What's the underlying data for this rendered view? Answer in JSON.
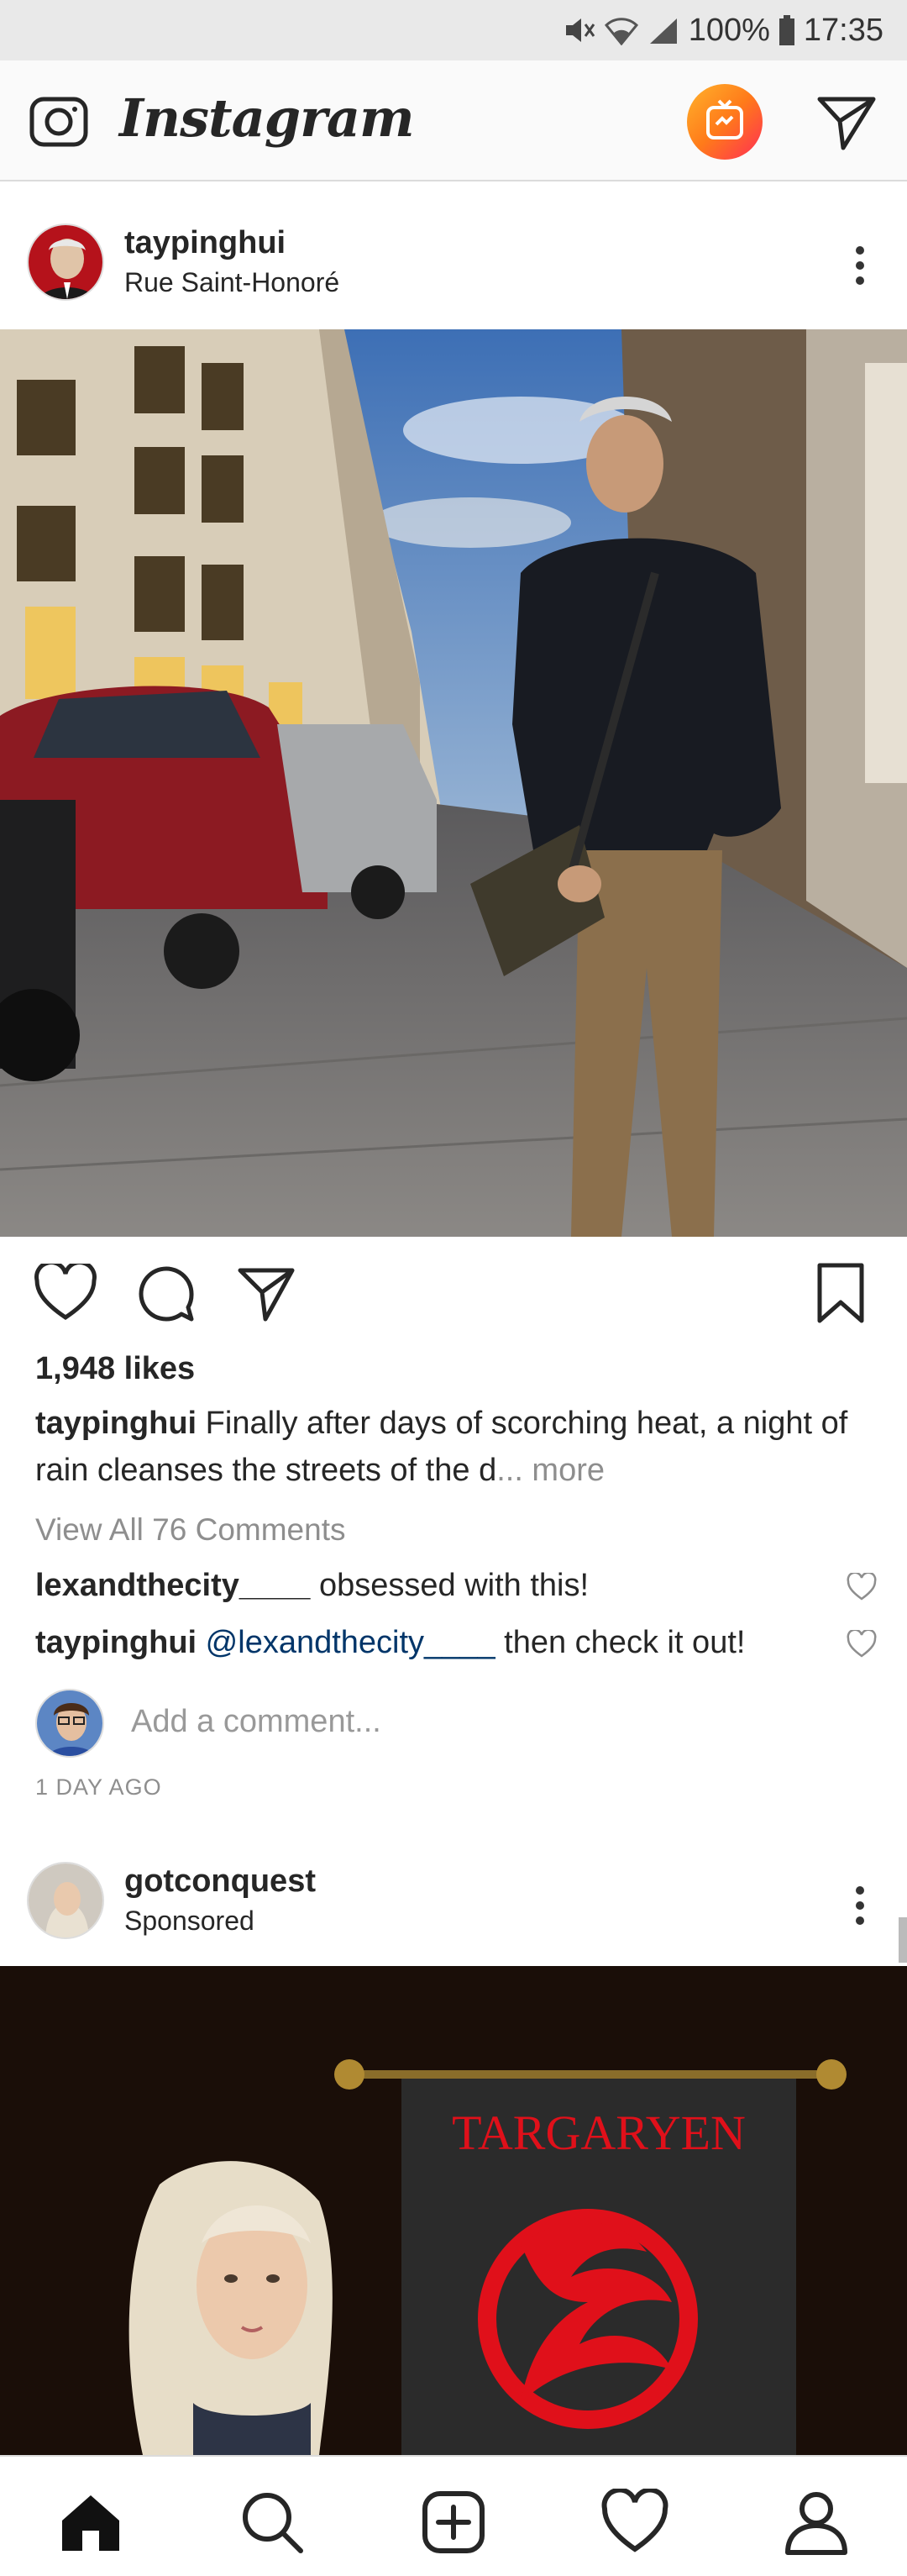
{
  "status_bar": {
    "battery": "100%",
    "time": "17:35",
    "icons": [
      "mute-icon",
      "wifi-icon",
      "signal-icon",
      "battery-icon"
    ]
  },
  "header": {
    "logo": "Instagram",
    "icons": [
      "camera-icon",
      "igtv-icon",
      "direct-message-icon"
    ]
  },
  "post1": {
    "username": "taypinghui",
    "location": "Rue Saint-Honoré",
    "likes": "1,948 likes",
    "caption_user": "taypinghui",
    "caption_text": "Finally after days of scorching heat, a night of rain cleanses  the streets of the d",
    "caption_more": "... more",
    "view_all": "View All 76 Comments",
    "comments": [
      {
        "user": "lexandthecity____",
        "text": "obsessed with this!"
      },
      {
        "user": "taypinghui",
        "mention": "@lexandthecity____",
        "text": "then check it out!"
      }
    ],
    "add_comment_placeholder": "Add a comment...",
    "timestamp": "1 DAY AGO"
  },
  "post2": {
    "username": "gotconquest",
    "sponsored": "Sponsored",
    "banner_text": "TARGARYEN"
  },
  "bottom_nav": {
    "items": [
      "home-icon",
      "search-icon",
      "new-post-icon",
      "activity-heart-icon",
      "profile-icon"
    ]
  },
  "colors": {
    "accent_blue": "#003569",
    "muted_gray": "#8e8e8e",
    "banner_red": "#e0101a"
  }
}
